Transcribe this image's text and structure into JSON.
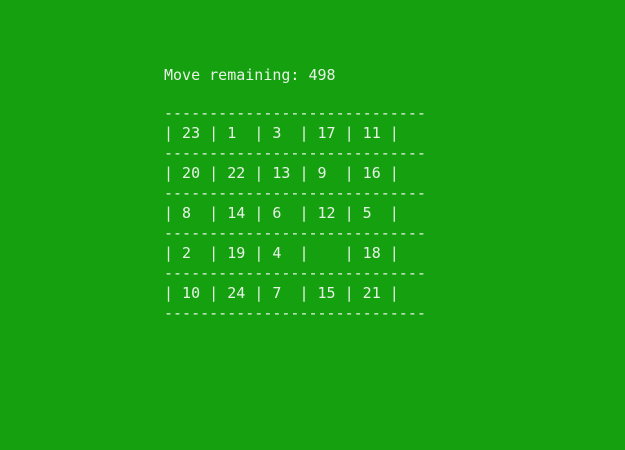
{
  "game": {
    "status_label": "Move remaining:",
    "moves_remaining": "498",
    "separator": "-----------------------------",
    "board": [
      [
        "23",
        "1",
        "3",
        "17",
        "11"
      ],
      [
        "20",
        "22",
        "13",
        "9",
        "16"
      ],
      [
        "8",
        "14",
        "6",
        "12",
        "5"
      ],
      [
        "2",
        "19",
        "4",
        "",
        "18"
      ],
      [
        "10",
        "24",
        "7",
        "15",
        "21"
      ]
    ]
  }
}
